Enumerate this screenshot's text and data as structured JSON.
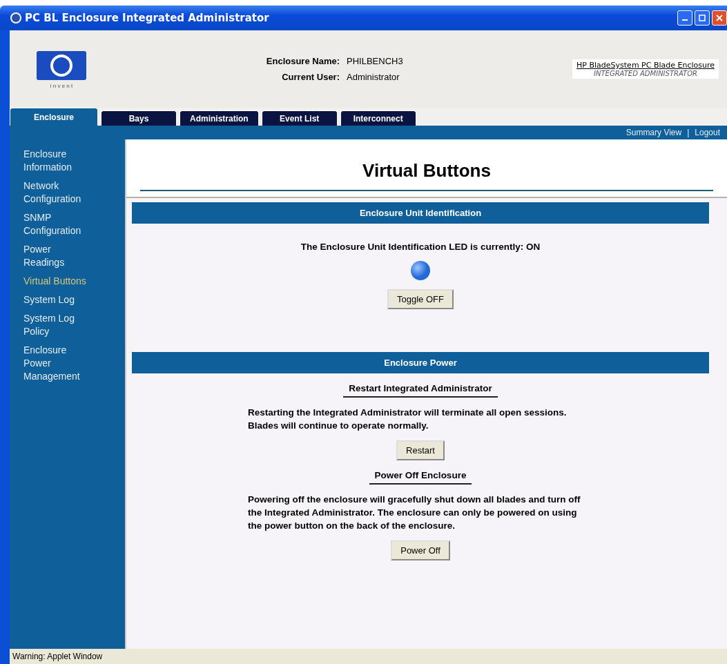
{
  "window": {
    "title": "PC BL Enclosure Integrated Administrator"
  },
  "header": {
    "fields": [
      {
        "label": "Enclosure Name:",
        "value": "PHILBENCH3"
      },
      {
        "label": "Current User:",
        "value": "Administrator"
      }
    ],
    "brand": {
      "line1": "HP BladeSystem PC Blade Enclosure",
      "line2": "INTEGRATED ADMINISTRATOR"
    },
    "logo_tagline": "i n v e n t"
  },
  "tabs": [
    {
      "label": "Enclosure",
      "selected": true
    },
    {
      "label": "Bays",
      "selected": false
    },
    {
      "label": "Administration",
      "selected": false
    },
    {
      "label": "Event List",
      "selected": false
    },
    {
      "label": "Interconnect",
      "selected": false
    }
  ],
  "links": [
    "Summary View",
    "Logout"
  ],
  "link_separator": "|",
  "sidebar": {
    "items": [
      {
        "label": "Enclosure Information",
        "selected": false
      },
      {
        "label": "Network Configuration",
        "selected": false
      },
      {
        "label": "SNMP Configuration",
        "selected": false
      },
      {
        "label": "Power Readings",
        "selected": false
      },
      {
        "label": "Virtual Buttons",
        "selected": true
      },
      {
        "label": "System Log",
        "selected": false
      },
      {
        "label": "System Log Policy",
        "selected": false
      },
      {
        "label": "Enclosure Power Management",
        "selected": false
      }
    ]
  },
  "page_title": "Virtual Buttons",
  "uid_section": {
    "heading": "Enclosure Unit Identification",
    "status": "The Enclosure Unit Identification LED is currently: ON",
    "led_on": true,
    "button": "Toggle OFF"
  },
  "power_section": {
    "heading": "Enclosure Power",
    "blocks": [
      {
        "title": "Restart Integrated Administrator",
        "text": "Restarting the Integrated Administrator will terminate all open sessions. Blades will continue to operate normally.",
        "button": "Restart"
      },
      {
        "title": "Power Off Enclosure",
        "text": "Powering off the enclosure will gracefully shut down all blades and turn off the Integrated Administrator. The enclosure can only be powered on using the power button on the back of the enclosure.",
        "button": "Power Off"
      }
    ]
  },
  "status_bar": "Warning: Applet Window"
}
